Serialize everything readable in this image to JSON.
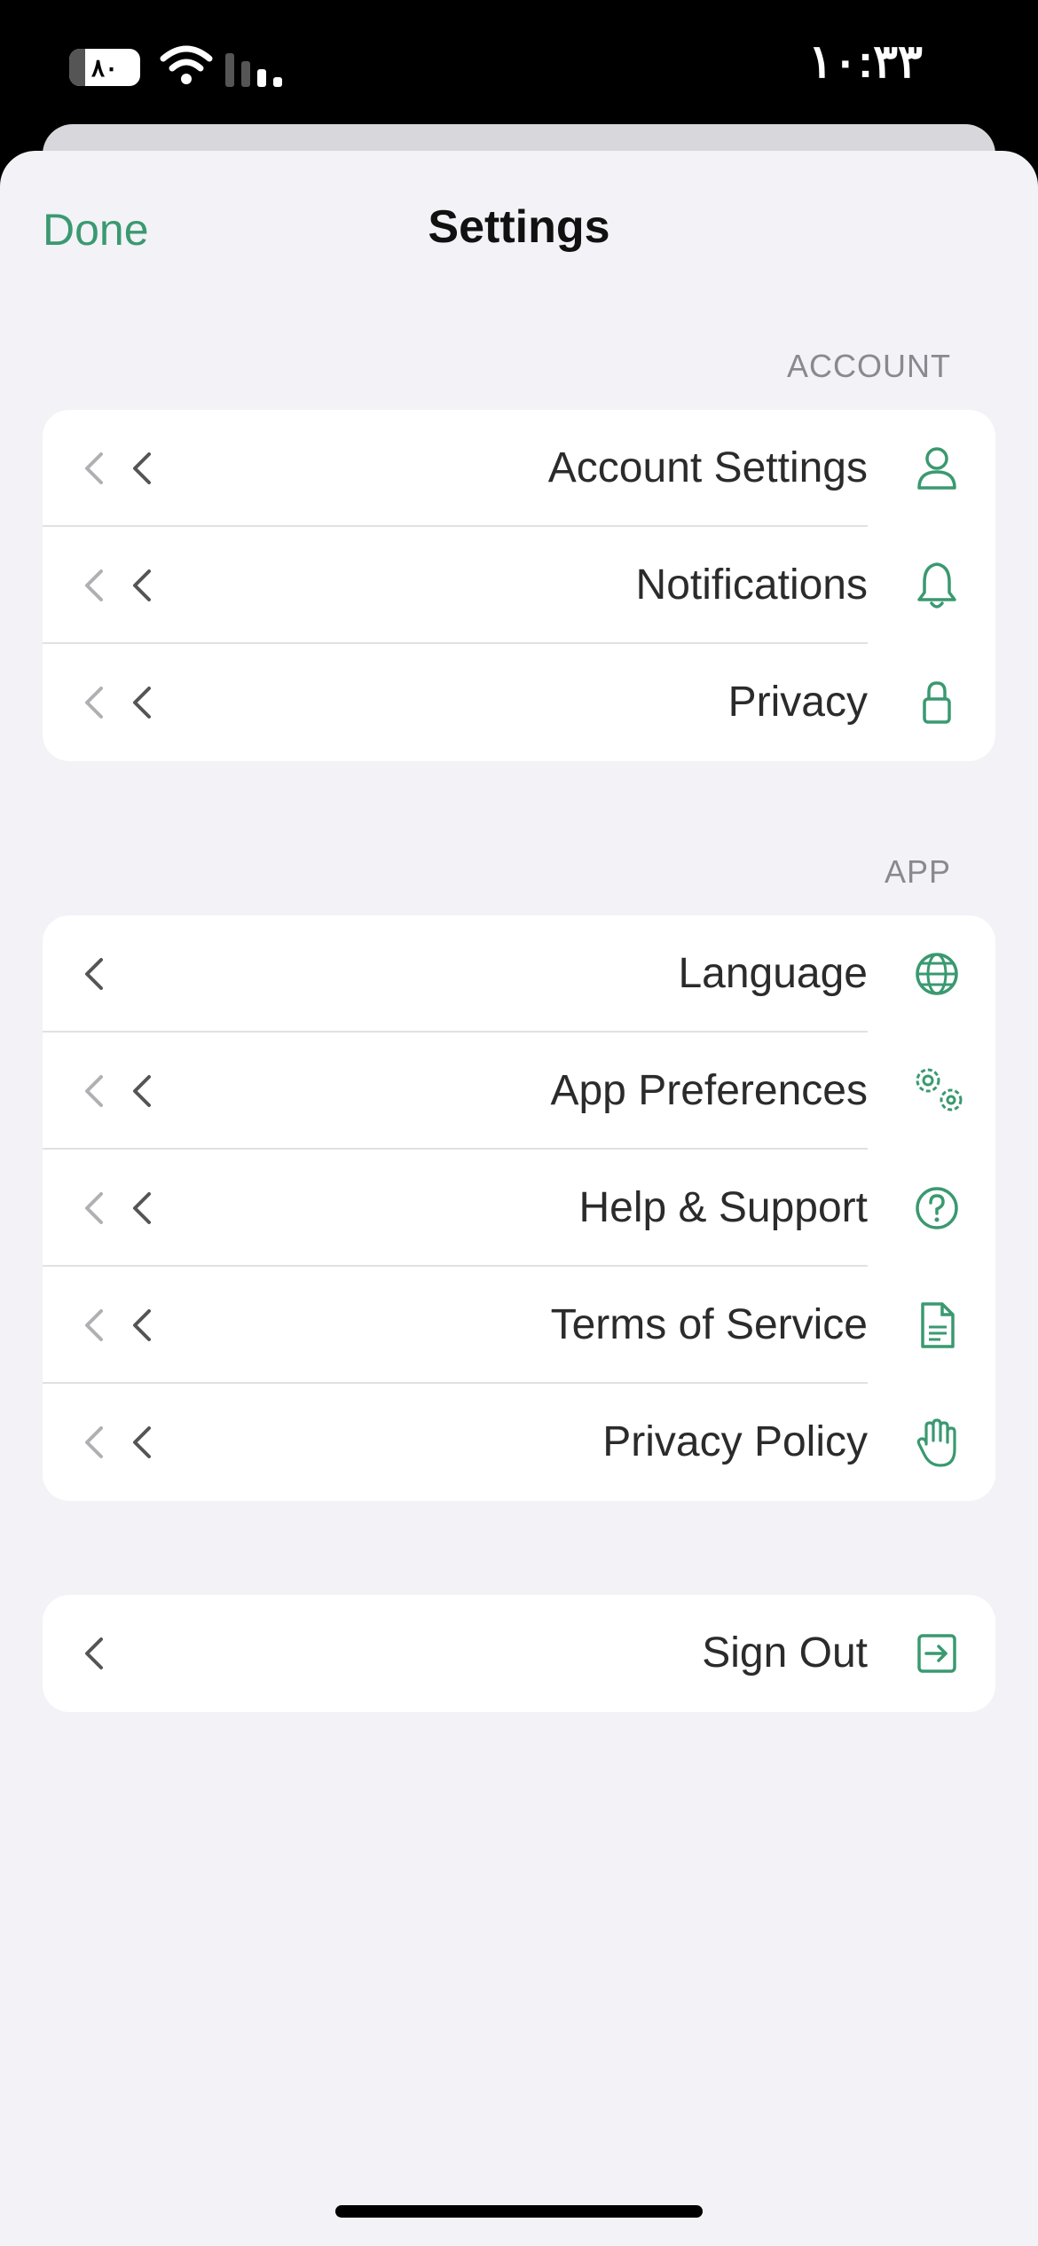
{
  "status_bar": {
    "battery": "۸۰",
    "time": "۱۰:۳۳"
  },
  "header": {
    "done_label": "Done",
    "title": "Settings"
  },
  "sections": {
    "account": {
      "header": "ACCOUNT",
      "items": [
        {
          "label": "Account Settings",
          "icon": "person-icon"
        },
        {
          "label": "Notifications",
          "icon": "bell-icon"
        },
        {
          "label": "Privacy",
          "icon": "lock-icon"
        }
      ]
    },
    "app": {
      "header": "APP",
      "items": [
        {
          "label": "Language",
          "icon": "globe-icon"
        },
        {
          "label": "App Preferences",
          "icon": "gears-icon"
        },
        {
          "label": "Help & Support",
          "icon": "question-circle-icon"
        },
        {
          "label": "Terms of Service",
          "icon": "document-icon"
        },
        {
          "label": "Privacy Policy",
          "icon": "hand-icon"
        }
      ]
    },
    "signout": {
      "items": [
        {
          "label": "Sign Out",
          "icon": "sign-out-icon"
        }
      ]
    }
  },
  "colors": {
    "accent": "#3a9970",
    "background": "#f2f2f7",
    "chevron_light": "#b0b0b4",
    "chevron_dark": "#555555"
  }
}
